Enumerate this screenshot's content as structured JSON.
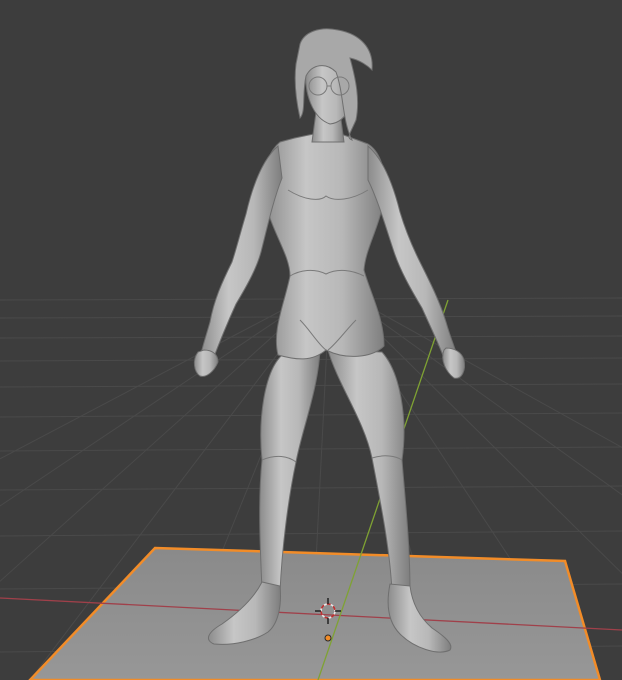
{
  "viewport": {
    "background": "#3d3d3d",
    "grid_color": "#4a4a4a",
    "x_axis_color": "#a0404a",
    "y_axis_color": "#7fa233",
    "selection_outline_color": "#f28c28",
    "plane_color": "#8e8e8e",
    "mesh_color": "#b4b4b4"
  },
  "scene": {
    "objects": [
      {
        "kind": "mesh",
        "shading": "solid"
      },
      {
        "kind": "plane",
        "selected": true
      },
      {
        "kind": "3d-cursor"
      },
      {
        "kind": "origin-point"
      }
    ]
  }
}
